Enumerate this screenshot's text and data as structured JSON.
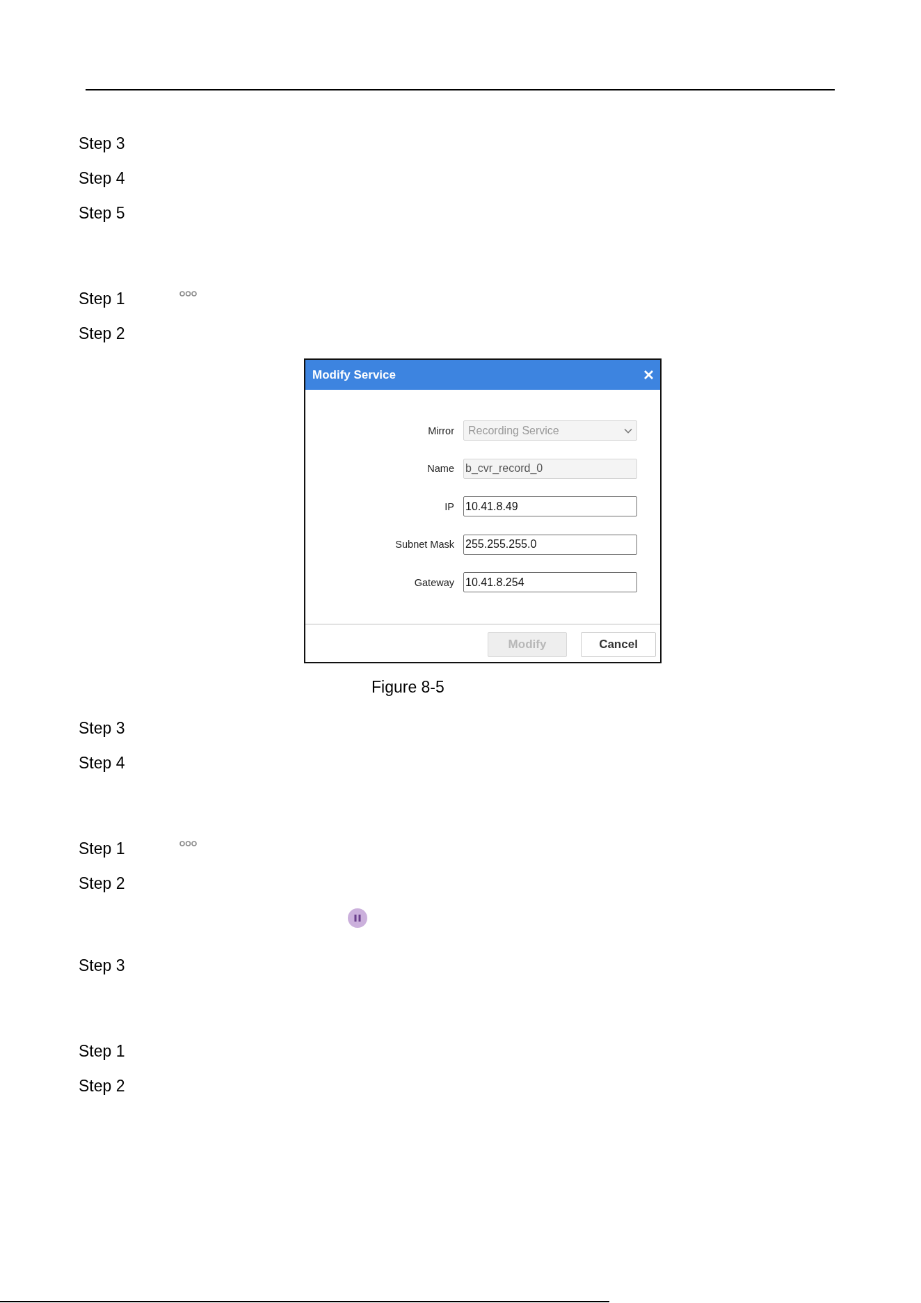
{
  "sections": [
    {
      "items": [
        {
          "kind": "step",
          "label": "Step 3"
        },
        {
          "kind": "step",
          "label": "Step 4"
        },
        {
          "kind": "step",
          "label": "Step 5"
        }
      ]
    },
    {
      "items": [
        {
          "kind": "more",
          "label": "Step 1"
        },
        {
          "kind": "step",
          "label": "Step 2"
        },
        {
          "kind": "figure",
          "dialog": {
            "title": "Modify Service",
            "fields": [
              {
                "label": "Mirror",
                "kind": "select",
                "value": "Recording Service",
                "disabled": true
              },
              {
                "label": "Name",
                "kind": "text",
                "value": "b_cvr_record_0",
                "disabled": true
              },
              {
                "label": "IP",
                "kind": "text",
                "value": "10.41.8.49",
                "disabled": false
              },
              {
                "label": "Subnet Mask",
                "kind": "text",
                "value": "255.255.255.0",
                "disabled": false
              },
              {
                "label": "Gateway",
                "kind": "text",
                "value": "10.41.8.254",
                "disabled": false
              }
            ],
            "buttons": [
              {
                "label": "Modify",
                "disabled": true
              },
              {
                "label": "Cancel",
                "disabled": false
              }
            ]
          },
          "caption": "Figure 8-5"
        },
        {
          "kind": "step",
          "label": "Step 3"
        },
        {
          "kind": "step",
          "label": "Step 4"
        }
      ]
    },
    {
      "items": [
        {
          "kind": "more",
          "label": "Step 1"
        },
        {
          "kind": "step",
          "label": "Step 2"
        },
        {
          "kind": "pause"
        },
        {
          "kind": "step",
          "label": "Step 3"
        }
      ]
    },
    {
      "items": [
        {
          "kind": "step",
          "label": "Step 1"
        },
        {
          "kind": "step",
          "label": "Step 2"
        }
      ]
    }
  ]
}
